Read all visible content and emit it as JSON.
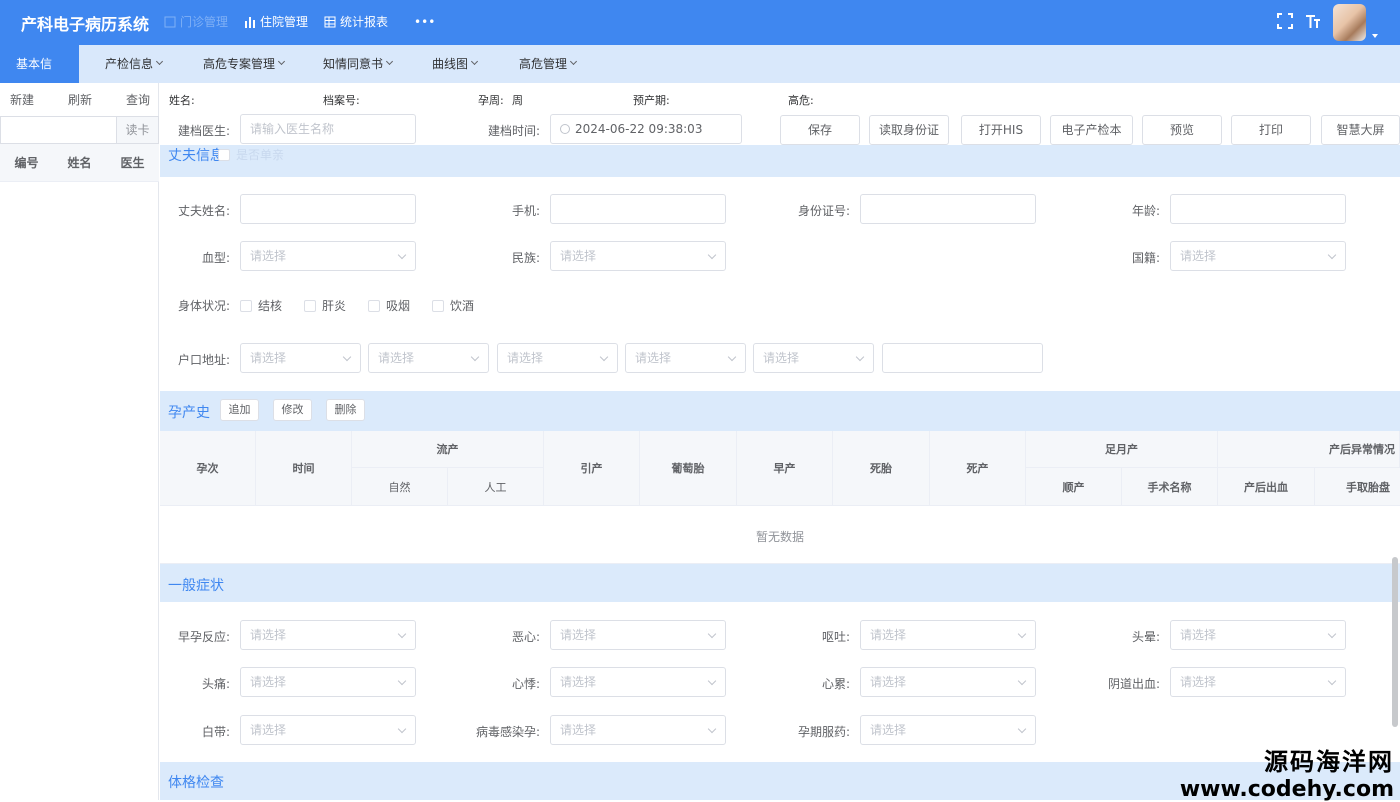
{
  "app": {
    "title": "产科电子病历系统",
    "nav": [
      "门诊管理",
      "住院管理",
      "统计报表",
      "•••"
    ]
  },
  "menu": {
    "items": [
      "基本信息",
      "产检信息",
      "高危专案管理",
      "知情同意书",
      "曲线图",
      "高危管理"
    ]
  },
  "sidebar": {
    "tools": [
      "新建",
      "刷新",
      "查询"
    ],
    "read_card": "读卡",
    "columns": [
      "编号",
      "姓名",
      "医生"
    ]
  },
  "patient_info": {
    "name_label": "姓名:",
    "file_label": "档案号:",
    "week_label": "孕周:",
    "week_value": "周",
    "due_label": "预产期:",
    "risk_label": "高危:"
  },
  "doc_row": {
    "doctor_label": "建档医生:",
    "doctor_placeholder": "请输入医生名称",
    "time_label": "建档时间:",
    "time_value": "2024-06-22 09:38:03",
    "buttons": [
      "保存",
      "读取身份证",
      "打开HIS",
      "电子产检本",
      "预览",
      "打印",
      "智慧大屏"
    ]
  },
  "husband": {
    "title": "丈夫信息",
    "single_parent": "是否单亲",
    "name_label": "丈夫姓名:",
    "phone_label": "手机:",
    "id_label": "身份证号:",
    "age_label": "年龄:",
    "blood_label": "血型:",
    "ethnic_label": "民族:",
    "nation_label": "国籍:",
    "select_placeholder": "请选择",
    "health_label": "身体状况:",
    "health_options": [
      "结核",
      "肝炎",
      "吸烟",
      "饮酒"
    ],
    "address_label": "户口地址:"
  },
  "history": {
    "title": "孕产史",
    "buttons": [
      "追加",
      "修改",
      "删除"
    ],
    "headers": {
      "pregnancy": "孕次",
      "time": "时间",
      "abortion": "流产",
      "natural": "自然",
      "artificial": "人工",
      "induced": "引产",
      "mole": "葡萄胎",
      "premature": "早产",
      "stillbirth": "死胎",
      "dead_birth": "死产",
      "full_term": "足月产",
      "normal": "顺产",
      "surgery": "手术名称",
      "postpartum": "产后异常情况",
      "bleeding": "产后出血",
      "placenta": "手取胎盘"
    },
    "empty_text": "暂无数据"
  },
  "symptoms": {
    "title": "一般症状",
    "fields": [
      "早孕反应:",
      "恶心:",
      "呕吐:",
      "头晕:",
      "头痛:",
      "心悸:",
      "心累:",
      "阴道出血:",
      "白带:",
      "病毒感染孕:",
      "孕期服药:"
    ],
    "select_placeholder": "请选择"
  },
  "exam": {
    "title": "体格检查"
  },
  "watermark": {
    "cn": "源码海洋网",
    "url": "www.codehy.com"
  },
  "colors": {
    "primary": "#3f87f0",
    "section_bg": "#dbeafb"
  }
}
